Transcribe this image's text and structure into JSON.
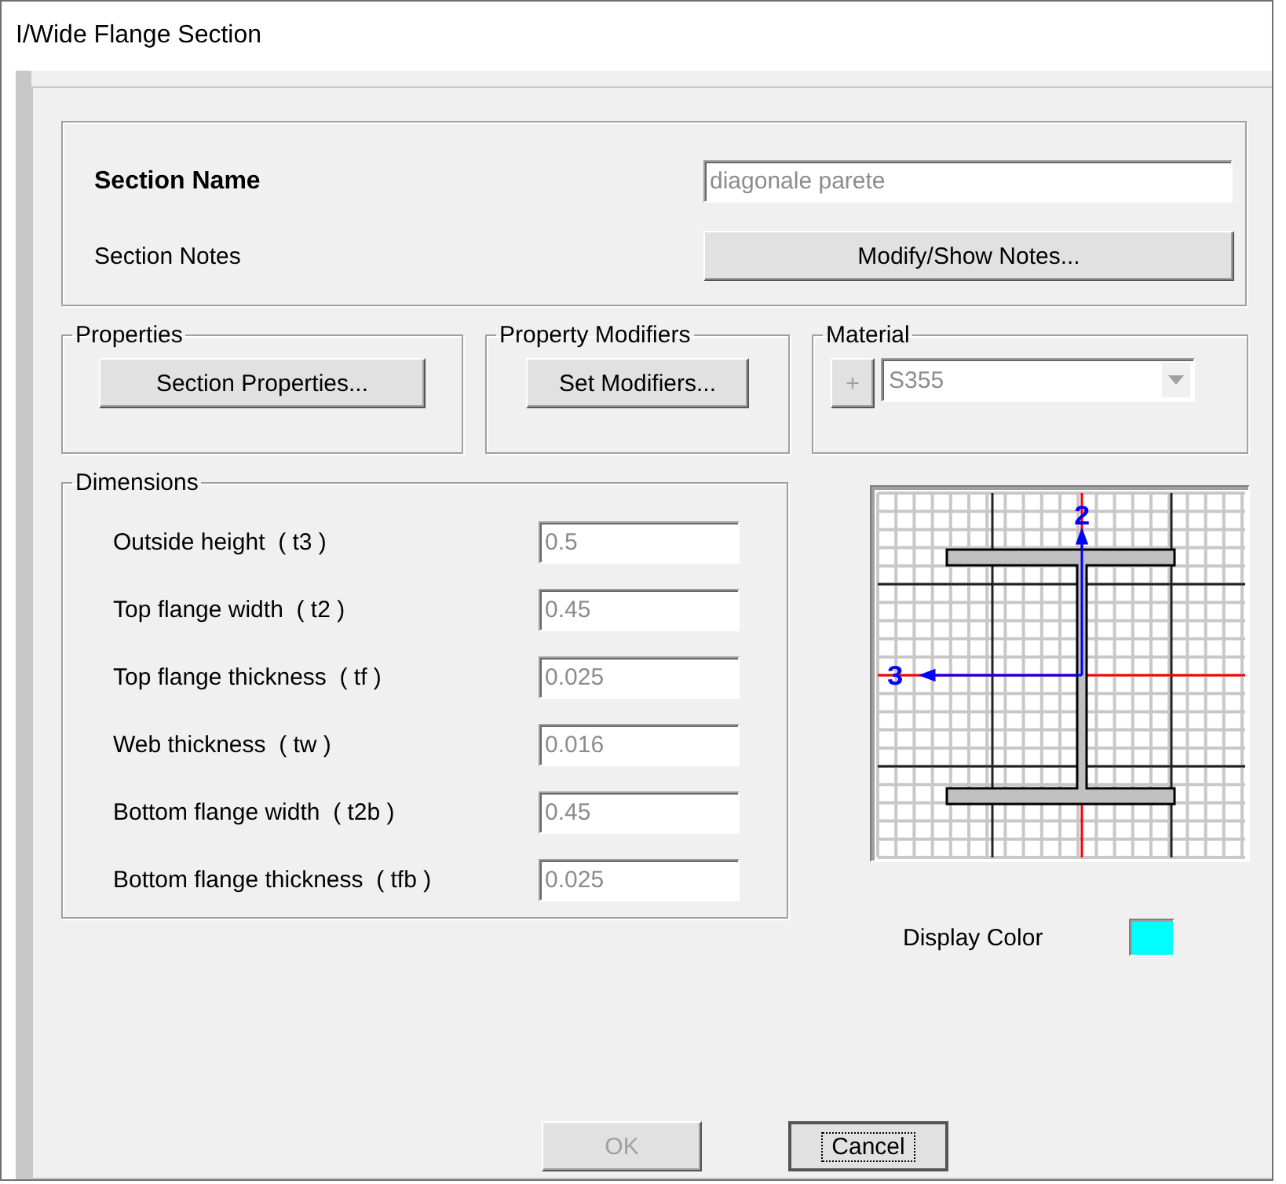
{
  "window": {
    "title": "I/Wide Flange Section"
  },
  "section_name": {
    "label": "Section Name",
    "value": "diagonale parete",
    "disabled": true
  },
  "section_notes": {
    "label": "Section Notes",
    "button": "Modify/Show Notes..."
  },
  "properties": {
    "title": "Properties",
    "button": "Section Properties..."
  },
  "property_modifiers": {
    "title": "Property Modifiers",
    "button": "Set Modifiers..."
  },
  "material": {
    "title": "Material",
    "add_button": "+",
    "value": "S355",
    "disabled": true
  },
  "dimensions": {
    "title": "Dimensions",
    "rows": [
      {
        "label": "Outside height  ( t3 )",
        "value": "0.5",
        "disabled": true
      },
      {
        "label": "Top flange width  ( t2 )",
        "value": "0.45",
        "disabled": true
      },
      {
        "label": "Top flange thickness  ( tf )",
        "value": "0.025",
        "disabled": true
      },
      {
        "label": "Web thickness  ( tw )",
        "value": "0.016",
        "disabled": true
      },
      {
        "label": "Bottom flange width  ( t2b )",
        "value": "0.45",
        "disabled": true
      },
      {
        "label": "Bottom flange thickness  ( tfb )",
        "value": "0.025",
        "disabled": true
      }
    ]
  },
  "preview": {
    "axis_labels": [
      "2",
      "3"
    ]
  },
  "display_color": {
    "label": "Display Color",
    "color": "#00ffff"
  },
  "buttons": [
    {
      "label": "OK",
      "disabled": true,
      "focused": false
    },
    {
      "label": "Cancel",
      "disabled": false,
      "focused": true
    }
  ]
}
